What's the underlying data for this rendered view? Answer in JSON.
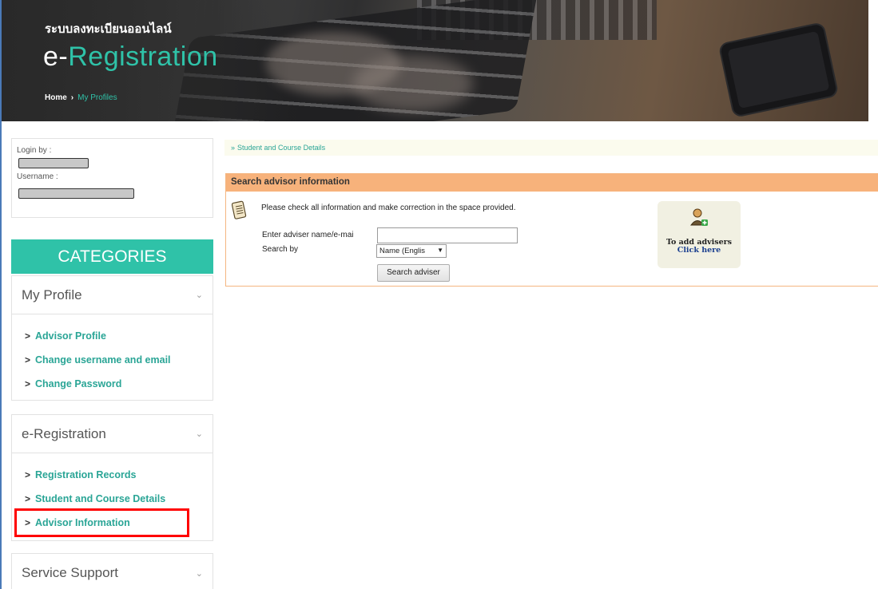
{
  "header": {
    "thai_title": "ระบบลงทะเบียนออนไลน์",
    "title_prefix": "e-",
    "title_accent": "Registration",
    "breadcrumb": {
      "home": "Home",
      "separator": "›",
      "current": "My Profiles"
    }
  },
  "login": {
    "login_by_label": "Login by :",
    "username_label": "Username :"
  },
  "sidebar": {
    "categories_title": "CATEGORIES",
    "panels": [
      {
        "title": "My Profile",
        "items": [
          "Advisor Profile",
          "Change username and email",
          "Change Password"
        ]
      },
      {
        "title": "e-Registration",
        "items": [
          "Registration Records",
          "Student and Course Details",
          "Advisor Information"
        ]
      },
      {
        "title": "Service Support",
        "items": []
      }
    ],
    "highlighted_item": "Advisor Information"
  },
  "main": {
    "breadcrumb": "Student and Course Details",
    "search": {
      "title": "Search advisor information",
      "instruction": "Please check all information and make correction in the space provided.",
      "name_label": "Enter adviser name/e-mai",
      "name_value": "",
      "search_by_label": "Search by",
      "search_by_value": "Name (Englis",
      "button_label": "Search adviser"
    },
    "add_card": {
      "line1": "To add advisers",
      "line2": "Click here"
    }
  },
  "colors": {
    "accent": "#2fc2a8",
    "link": "#2aa596",
    "search_header": "#f7b27b",
    "highlight_box": "#ff0000"
  }
}
